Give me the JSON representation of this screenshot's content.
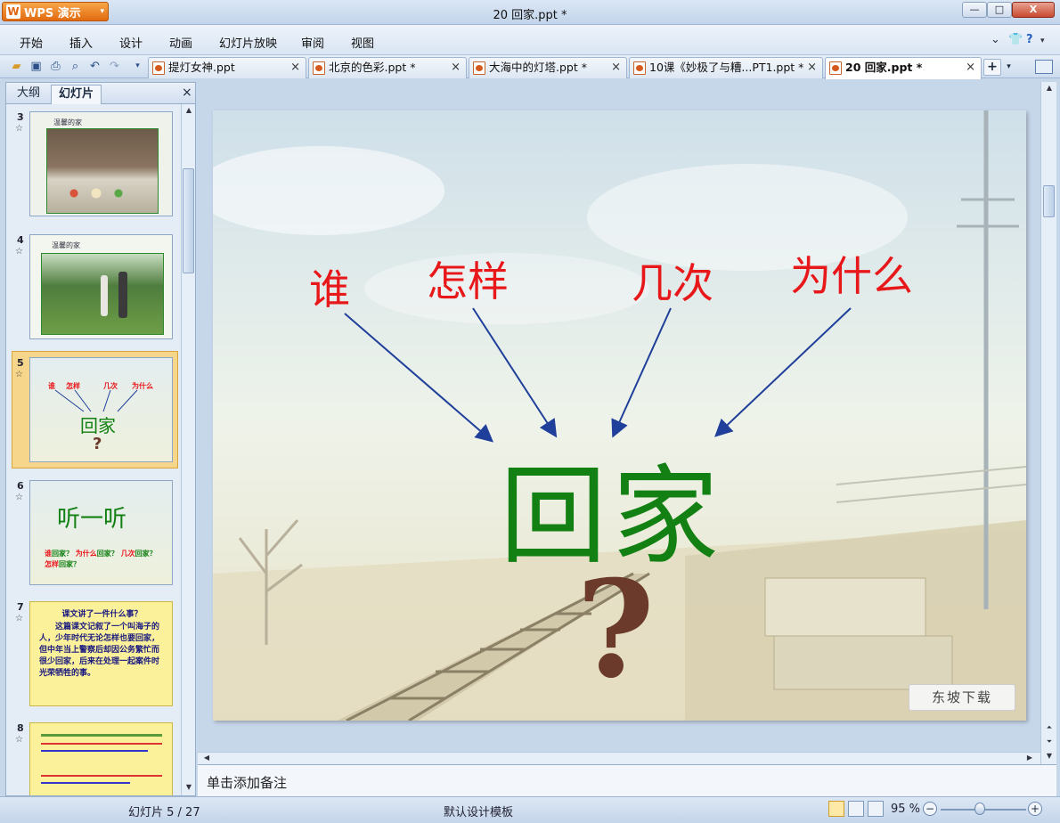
{
  "titlebar": {
    "app_button": "WPS 演示",
    "doc_title": "20 回家.ppt *",
    "minimize": "—",
    "maximize": "□",
    "close": "X"
  },
  "menu": {
    "items": [
      "开始",
      "插入",
      "设计",
      "动画",
      "幻灯片放映",
      "审阅",
      "视图"
    ],
    "right_icons": [
      "chevron-down-icon",
      "shirt-icon",
      "help-icon"
    ]
  },
  "toolbar": {
    "icons": [
      "open-icon",
      "save-icon",
      "print-icon",
      "print-preview-icon",
      "undo-icon",
      "redo-icon",
      "customize-icon"
    ]
  },
  "tabs": [
    {
      "label": "提灯女神.ppt"
    },
    {
      "label": "北京的色彩.ppt *"
    },
    {
      "label": "大海中的灯塔.ppt *"
    },
    {
      "label": "10课《妙极了与糟...PT1.ppt *"
    },
    {
      "label": "20 回家.ppt *",
      "active": true
    }
  ],
  "tab_close": "×",
  "new_tab": "+",
  "left_panel": {
    "tabs": [
      "大纲",
      "幻灯片"
    ],
    "active_tab": "幻灯片",
    "close": "×",
    "slides": [
      {
        "num": "3",
        "star": "☆",
        "heading": "温馨的家",
        "kind": "photo-dinner"
      },
      {
        "num": "4",
        "star": "☆",
        "heading": "温馨的家",
        "kind": "photo-park"
      },
      {
        "num": "5",
        "star": "☆",
        "kind": "title",
        "selected": true,
        "words": [
          "谁",
          "怎样",
          "几次",
          "为什么"
        ],
        "main": "回家",
        "mark": "?"
      },
      {
        "num": "6",
        "star": "☆",
        "kind": "listen",
        "main": "听一听",
        "line1": [
          "谁",
          "回家？",
          "为什么",
          "回家？",
          "几次",
          "回家？"
        ],
        "line2": [
          "怎样",
          "回家？"
        ]
      },
      {
        "num": "7",
        "star": "☆",
        "kind": "text",
        "heading": "课文讲了一件什么事？",
        "body": "这篇课文记叙了一个叫海子的人，少年时代无论怎样也要回家，但中年当上警察后却因公务繁忙而很少回家，后来在处理一起案件时光荣牺牲的事。"
      },
      {
        "num": "8",
        "star": "☆",
        "kind": "outline"
      }
    ]
  },
  "slide": {
    "words": [
      "谁",
      "怎样",
      "几次",
      "为什么"
    ],
    "main": "回家",
    "mark": "?",
    "watermark": "东坡下载",
    "colors": {
      "question_words": "#e8171a",
      "main_title": "#128012",
      "arrows": "#1f3f9a"
    }
  },
  "notes": {
    "placeholder": "单击添加备注"
  },
  "status": {
    "slide_counter": "幻灯片 5 / 27",
    "template": "默认设计模板",
    "zoom": "95 %",
    "zoom_minus": "−",
    "zoom_plus": "+"
  }
}
